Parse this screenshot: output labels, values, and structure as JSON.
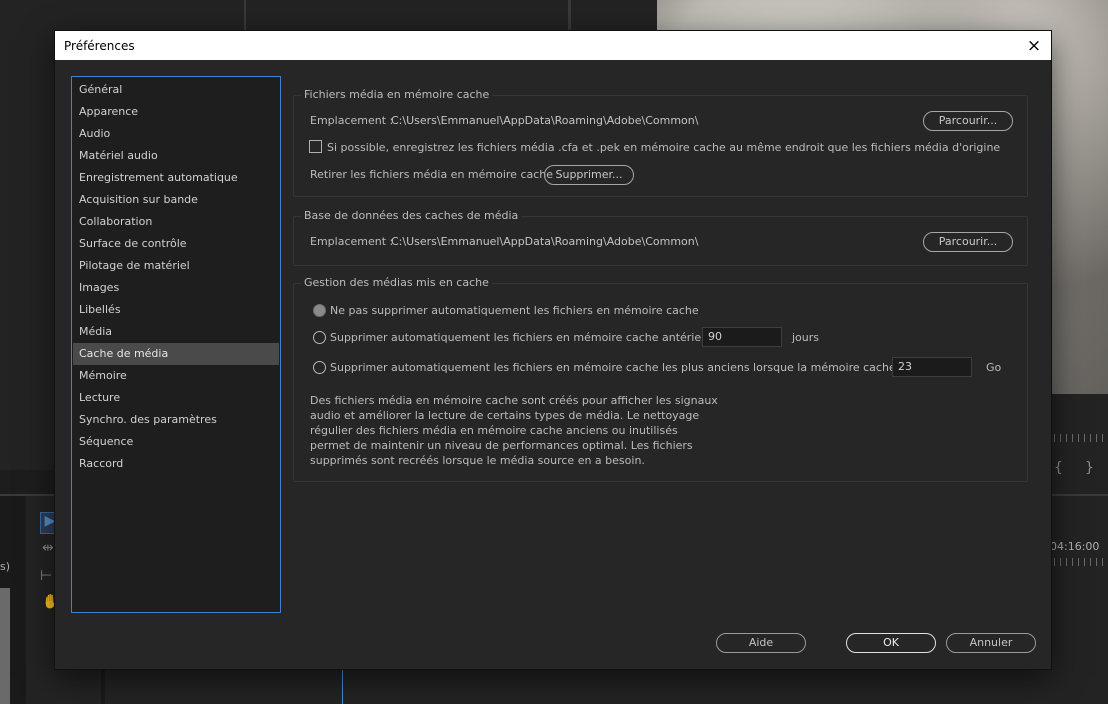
{
  "background": {
    "timecode": "04:16:00",
    "left_label": "s)"
  },
  "dialog": {
    "title": "Préférences",
    "close_icon": "×"
  },
  "sidebar": {
    "items": [
      {
        "label": "Général"
      },
      {
        "label": "Apparence"
      },
      {
        "label": "Audio"
      },
      {
        "label": "Matériel audio"
      },
      {
        "label": "Enregistrement automatique"
      },
      {
        "label": "Acquisition sur bande"
      },
      {
        "label": "Collaboration"
      },
      {
        "label": "Surface de contrôle"
      },
      {
        "label": "Pilotage de matériel"
      },
      {
        "label": "Images"
      },
      {
        "label": "Libellés"
      },
      {
        "label": "Média"
      },
      {
        "label": "Cache de média"
      },
      {
        "label": "Mémoire"
      },
      {
        "label": "Lecture"
      },
      {
        "label": "Synchro. des paramètres"
      },
      {
        "label": "Séquence"
      },
      {
        "label": "Raccord"
      }
    ],
    "selected": "Cache de média"
  },
  "media_cache_files": {
    "title": "Fichiers média en mémoire cache",
    "location_label": "Emplacement :",
    "location_path": "C:\\Users\\Emmanuel\\AppData\\Roaming\\Adobe\\Common\\",
    "browse_label": "Parcourir...",
    "save_next_to_originals_label": "Si possible, enregistrez les fichiers média .cfa et .pek en mémoire cache au même endroit que les fichiers média d'origine",
    "save_next_to_originals_checked": false,
    "remove_label": "Retirer les fichiers média en mémoire cache",
    "delete_label": "Supprimer..."
  },
  "media_cache_database": {
    "title": "Base de données des caches de média",
    "location_label": "Emplacement :",
    "location_path": "C:\\Users\\Emmanuel\\AppData\\Roaming\\Adobe\\Common\\",
    "browse_label": "Parcourir..."
  },
  "cache_management": {
    "title": "Gestion des médias mis en cache",
    "option_none_label": "Ne pas supprimer automatiquement les fichiers en mémoire cache",
    "option_older_label": "Supprimer automatiquement les fichiers en mémoire cache antérieurs à :",
    "older_value": "90",
    "older_unit": "jours",
    "option_size_label": "Supprimer automatiquement les fichiers en mémoire cache les plus anciens lorsque la mémoire cache dépasse :",
    "size_value": "23",
    "size_unit": "Go",
    "selected_option": "none",
    "info_text": "Des fichiers média en mémoire cache sont créés pour afficher les signaux audio et améliorer la lecture de certains types de média. Le nettoyage régulier des fichiers média en mémoire cache anciens ou inutilisés permet de maintenir un niveau de performances optimal. Les fichiers supprimés sont recréés lorsque le média source en a besoin."
  },
  "footer": {
    "help_label": "Aide",
    "ok_label": "OK",
    "cancel_label": "Annuler"
  }
}
